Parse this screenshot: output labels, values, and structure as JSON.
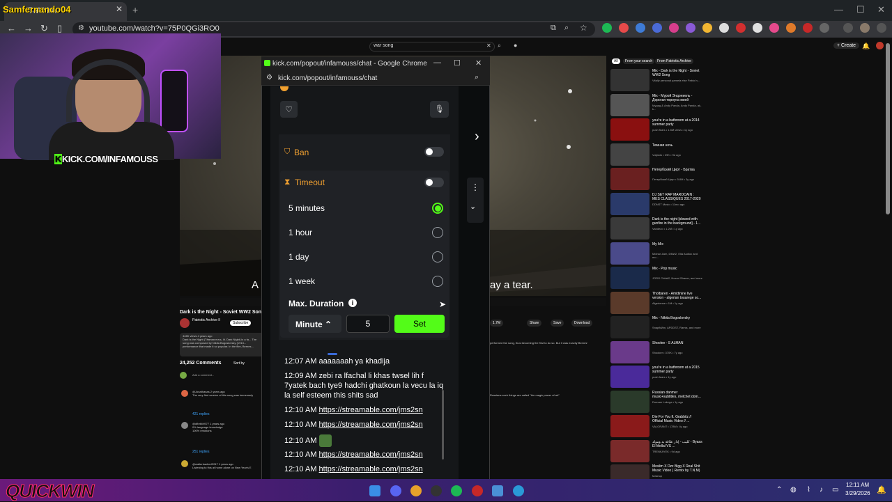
{
  "browser": {
    "tab_title": "Bakhira",
    "url": "youtube.com/watch?v=75P0QGi3RO0"
  },
  "youtube": {
    "search_value": "war song",
    "create_label": "Create",
    "caption_left": "A",
    "caption_right": "ay a tear.",
    "video_title": "Dark is the Night - Soviet WW2 Song",
    "channel_name": "Patriotic Archive II",
    "subscribe_label": "Subscribe",
    "description": "446K views 4 years ago\nDark is the Night (Тёмная ночь, lit. Dark Night) is a fa... The song was composed by Nikita Bogoslovsky (1913... performance that made it so popular. In the film, Bernes...",
    "comments_count": "24,252 Comments",
    "sort_label": "Sort by",
    "add_comment": "Add a comment...",
    "comments": [
      {
        "text": "@Jonathanas 2 years ago\nThe very first version of this song was immensely",
        "replies": "421 replies"
      },
      {
        "text": "@dfbrbl/rl977 1 years ago\n0% language knowledge\n100% emotions",
        "replies": "251 replies"
      },
      {
        "text": "@walterbazberl2247 1 years ago\nListening to this at home alone on New Year's E",
        "replies": ""
      }
    ],
    "actions": [
      "1.7M",
      "Share",
      "Save",
      "Download"
    ],
    "right_desc": "performed the song, thus becoming the first to do so. But it was exactly Bernes'",
    "right_desc2": "Russians such things are called \"the magic power of art\"",
    "chips": [
      "All",
      "From your search",
      "From Patriotic Archive"
    ],
    "recommendations": [
      {
        "title": "Mix - Dark is the Night - Soviet WW2 Song",
        "meta": "Vitaliy personal pamela else Pablo Iv..."
      },
      {
        "title": "Mix - Мурой Эндониель - Дорогая тороуна моей",
        "meta": "Мурад & Andy Panda, Andy Panda, ak-k..."
      },
      {
        "title": "you're in a bathroom at a 2014 summer party",
        "meta": "push fears • 1.5M views • 1y ago"
      },
      {
        "title": "Темная ночь",
        "meta": "Voljanto • 29K • 9d ago"
      },
      {
        "title": "Петербский Цирт - Братва",
        "meta": "Петербский Цирт • 5.8M • 3y ago"
      },
      {
        "title": "DJ SET RAP MAROCAIN : MES CLASSIQUES 2017-2020",
        "meta": "DDNST Music • 11mo ago"
      },
      {
        "title": "Dark is the night [slowed with gunfire in the background] - 1...",
        "meta": "Vandezo • 1.2M • 1y ago"
      },
      {
        "title": "My Mix",
        "meta": "Midnar Zam, Dfdzf2, Ella Audioc and mo..."
      },
      {
        "title": "Mix - Pop music",
        "meta": "JORG Chfab2, Noemi Shaner, and more"
      },
      {
        "title": "Tholbaren - Amidinine live version - algerian touarege so...",
        "meta": "Algerienne • 1M • 1y ago"
      },
      {
        "title": "Mix - Nikita Bogoslovsky",
        "meta": "Snapfid/bn, APDDST, Ramis, and more"
      },
      {
        "title": "Shoolee - S ALMAN",
        "meta": "Shooker • 370K • 7y ago"
      },
      {
        "title": "you're in a bathroom at a 2015 summer party",
        "meta": "push fears • 1y ago"
      },
      {
        "title": "Russian danmer music+subtitles, melchet dom...",
        "meta": "Domaer Lokega • 1y ago"
      },
      {
        "title": "Die For You ft. Grabbitz // Official Music Video // ...",
        "meta": "VALORANT • 178M • 4y ago"
      },
      {
        "title": "كليب - إدار علاقة بد ومولد - Byaas El Mellal VS ...",
        "meta": "TRENKAYEK • 9d ago"
      },
      {
        "title": "Moslim X Dzz Bigg X Real Shit Music Video ( Remix by T.N.M)",
        "meta": "Mashup"
      }
    ]
  },
  "stream": {
    "streamer_name": "Samfernando04",
    "kick_url": "KICK.COM/INFAMOUSS",
    "overlay_brand": "QUICKWIN"
  },
  "popout": {
    "title": "kick.com/popout/infamouss/chat - Google Chrome",
    "url": "kick.com/popout/infamouss/chat",
    "ban_label": "Ban",
    "timeout_label": "Timeout",
    "options": [
      {
        "label": "5 minutes",
        "selected": true
      },
      {
        "label": "1 hour",
        "selected": false
      },
      {
        "label": "1 day",
        "selected": false
      },
      {
        "label": "1 week",
        "selected": false
      }
    ],
    "max_duration_label": "Max. Duration",
    "unit_label": "Minute",
    "duration_value": "5",
    "set_label": "Set",
    "accent_color": "#53fc18",
    "messages": [
      {
        "time": "12:07 AM",
        "text": "aaaaaaah ya khadija",
        "link": ""
      },
      {
        "time": "12:09 AM",
        "text": "zebi ra lfachal li khas twsel lih f 7yatek bach tye9 hadchi ghatkoun la vecu la iq la self esteem this shits sad",
        "link": ""
      },
      {
        "time": "12:10 AM",
        "text": "",
        "link": "https://streamable.com/jms2sn"
      },
      {
        "time": "12:10 AM",
        "text": "",
        "link": "https://streamable.com/jms2sn"
      },
      {
        "time": "12:10 AM",
        "text": "",
        "link": ""
      },
      {
        "time": "12:10 AM",
        "text": "",
        "link": "https://streamable.com/jms2sn"
      },
      {
        "time": "12:10 AM",
        "text": "",
        "link": "https://streamable.com/jms2sn"
      }
    ]
  },
  "taskbar": {
    "time": "12:11 AM",
    "date": "3/29/2026"
  }
}
